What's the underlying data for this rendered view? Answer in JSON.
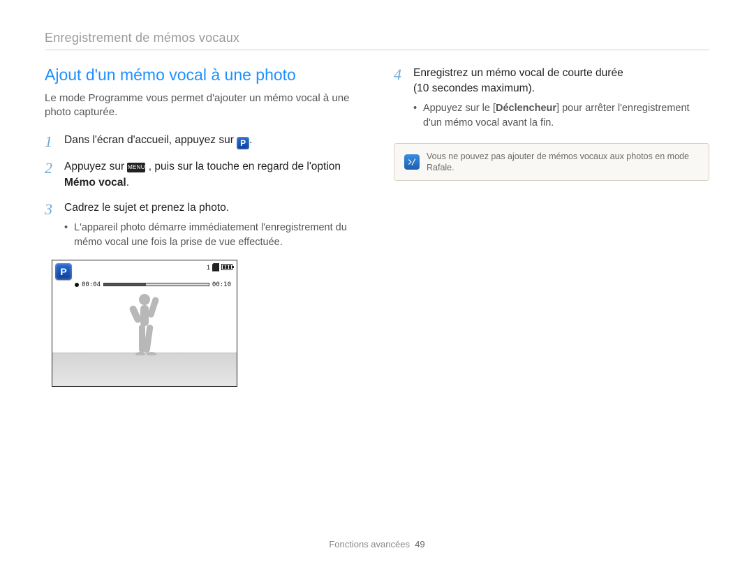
{
  "breadcrumb": "Enregistrement de mémos vocaux",
  "left": {
    "title": "Ajout d'un mémo vocal à une photo",
    "intro": "Le mode Programme vous permet d'ajouter un mémo vocal à une photo capturée.",
    "step1_pre": "Dans l'écran d'accueil, appuyez sur ",
    "step1_post": ".",
    "step2_pre": "Appuyez sur ",
    "step2_mid": ", puis sur la touche en regard de l'option ",
    "step2_bold": "Mémo vocal",
    "step2_post": ".",
    "step3": "Cadrez le sujet et prenez la photo.",
    "step3_sub": "L'appareil photo démarre immédiatement l'enregistrement du mémo vocal une fois la prise de vue effectuée."
  },
  "camera": {
    "p_label": "P",
    "top_icon_count": "1",
    "elapsed": "00:04",
    "total": "00:10",
    "progress_percent": 40
  },
  "right": {
    "step4_line1": "Enregistrez un mémo vocal de courte durée",
    "step4_line2": "(10 secondes maximum).",
    "step4_sub_pre": "Appuyez sur le [",
    "step4_sub_bold": "Déclencheur",
    "step4_sub_post": "] pour arrêter l'enregistrement d'un mémo vocal avant la fin.",
    "note": "Vous ne pouvez pas ajouter de mémos vocaux aux photos en mode Rafale."
  },
  "footer": {
    "section": "Fonctions avancées",
    "page": "49"
  },
  "icons": {
    "menu_label": "MENU"
  },
  "steps": {
    "n1": "1",
    "n2": "2",
    "n3": "3",
    "n4": "4"
  }
}
